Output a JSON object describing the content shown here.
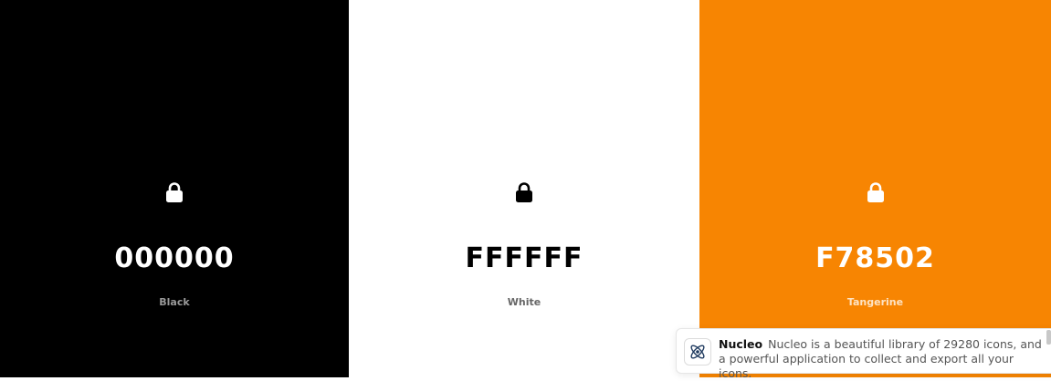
{
  "swatches": [
    {
      "hex": "000000",
      "name": "Black",
      "bg": "#000000",
      "fg": "#ffffff",
      "name_color": "#9a9a9a",
      "icon": "lock-icon"
    },
    {
      "hex": "FFFFFF",
      "name": "White",
      "bg": "#ffffff",
      "fg": "#000000",
      "name_color": "#666666",
      "icon": "lock-icon"
    },
    {
      "hex": "F78502",
      "name": "Tangerine",
      "bg": "#f78502",
      "fg": "#ffffff",
      "name_color": "#fde3c4",
      "icon": "lock-icon"
    }
  ],
  "toast": {
    "title": "Nucleo",
    "message": "Nucleo is a beautiful library of 29280 icons, and a powerful application to collect and export all your icons.",
    "icon": "atom-icon"
  }
}
